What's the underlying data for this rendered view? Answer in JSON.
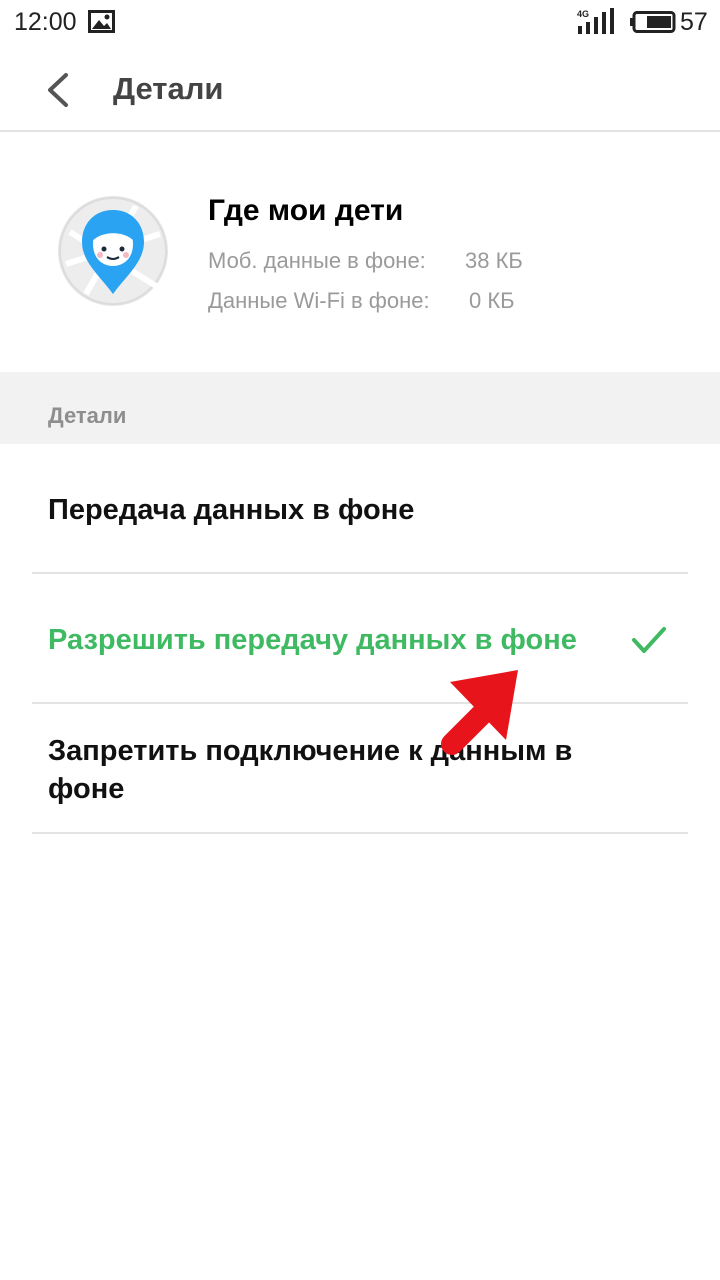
{
  "status_bar": {
    "time": "12:00",
    "network_label": "4G",
    "battery_level": "57",
    "icons": [
      "gallery-icon",
      "signal-icon",
      "battery-icon"
    ]
  },
  "toolbar": {
    "title": "Детали",
    "back_icon": "chevron-left-icon"
  },
  "app": {
    "name": "Где мои дети",
    "mobile_data_label": "Моб. данные в фоне:",
    "mobile_data_value": "38 КБ",
    "wifi_data_label": "Данные Wi-Fi в фоне:",
    "wifi_data_value": "0 КБ"
  },
  "section": {
    "header": "Детали"
  },
  "options": [
    {
      "label": "Передача данных в фоне",
      "selected": false
    },
    {
      "label": "Разрешить передачу данных в фоне",
      "selected": true
    },
    {
      "label": "Запретить подключение к данным в фоне",
      "selected": false
    }
  ],
  "colors": {
    "accent_green": "#3fba62",
    "annotation_red": "#e8141c",
    "app_icon_blue": "#29a3f2"
  }
}
